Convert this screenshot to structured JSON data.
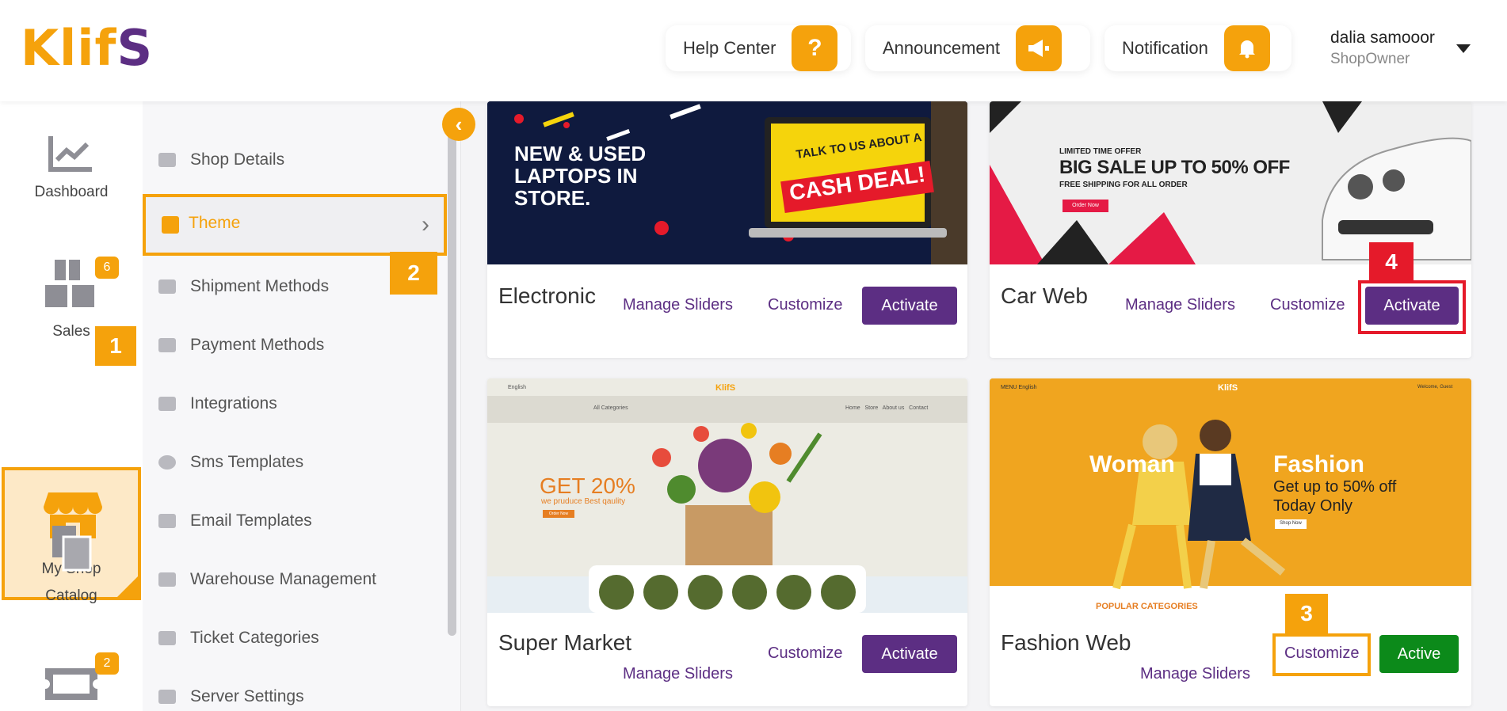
{
  "logo": {
    "main": "Klif",
    "accent": "S"
  },
  "header": {
    "help_center": "Help Center",
    "announcement": "Announcement",
    "notification": "Notification",
    "user_name": "dalia samooor",
    "user_role": "ShopOwner"
  },
  "rail": {
    "dashboard": "Dashboard",
    "sales": "Sales",
    "sales_badge": "6",
    "my_shop": "My Shop",
    "catalog": "Catalog",
    "tickets_badge": "2"
  },
  "submenu": {
    "shop_details": "Shop Details",
    "theme": "Theme",
    "shipment_methods": "Shipment Methods",
    "payment_methods": "Payment Methods",
    "integrations": "Integrations",
    "sms_templates": "Sms Templates",
    "email_templates": "Email Templates",
    "warehouse_management": "Warehouse Management",
    "ticket_categories": "Ticket Categories",
    "server_settings": "Server Settings"
  },
  "steps": {
    "s1": "1",
    "s2": "2",
    "s3": "3",
    "s4": "4"
  },
  "themes": [
    {
      "title": "Electronic",
      "manage": "Manage Sliders",
      "customize": "Customize",
      "action": "Activate",
      "banner": {
        "line1": "NEW & USED",
        "line2": "LAPTOPS IN",
        "line3": "STORE.",
        "screen1": "TALK TO US ABOUT A",
        "screen2": "CASH DEAL!"
      }
    },
    {
      "title": "Car Web",
      "manage": "Manage Sliders",
      "customize": "Customize",
      "action": "Activate",
      "banner": {
        "small1": "LIMITED TIME OFFER",
        "big": "BIG SALE UP TO 50% OFF",
        "small2": "FREE SHIPPING FOR ALL ORDER",
        "btn": "Order Now"
      }
    },
    {
      "title": "Super Market",
      "manage": "Manage Sliders",
      "customize": "Customize",
      "action": "Activate",
      "banner": {
        "lang": "English",
        "logo": "KlifS",
        "categories": "All Categories",
        "nav": "Home   Store   About us   Contact",
        "headline": "GET 20%",
        "sub": "we pruduce Best qaulity",
        "btn": "Order Now"
      }
    },
    {
      "title": "Fashion Web",
      "manage": "Manage Sliders",
      "customize": "Customize",
      "action": "Active",
      "banner": {
        "menu": "MENU  English",
        "logo": "KlifS",
        "welcome": "Welcome, Guest",
        "woman": "Woman",
        "fashion": "Fashion",
        "offer1": "Get up to 50% off",
        "offer2": "Today Only",
        "btn": "Shop Now",
        "popular": "POPULAR CATEGORIES"
      }
    }
  ],
  "colors": {
    "accent": "#f5a20c",
    "brand_purple": "#5c2e83",
    "active_green": "#0c8a1a",
    "highlight_red": "#e51a2a"
  }
}
